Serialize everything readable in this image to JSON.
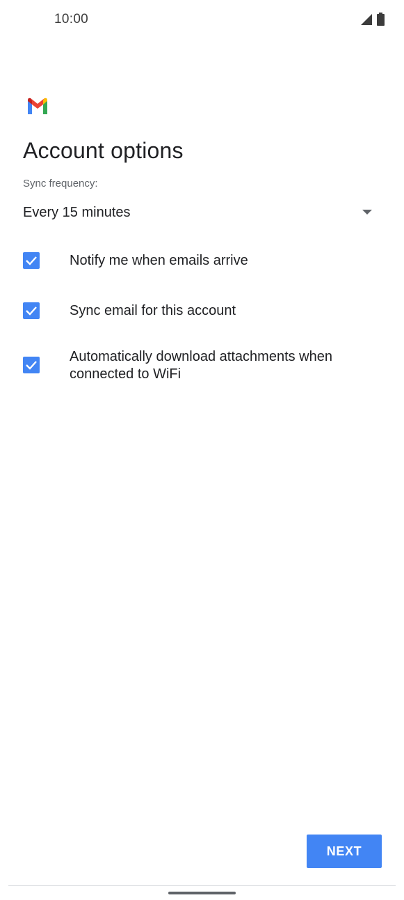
{
  "status_bar": {
    "time": "10:00",
    "icons": [
      "signal-icon",
      "battery-icon"
    ]
  },
  "app": {
    "logo": "gmail-logo",
    "brand_colors": {
      "blue": "#4285F4",
      "red": "#EA4335",
      "yellow": "#FBBC04",
      "green": "#34A853"
    }
  },
  "header": {
    "title": "Account options"
  },
  "sync": {
    "label": "Sync frequency:",
    "selected": "Every 15 minutes"
  },
  "options": [
    {
      "label": "Notify me when emails arrive",
      "checked": true
    },
    {
      "label": "Sync email for this account",
      "checked": true
    },
    {
      "label": "Automatically download attachments when connected to WiFi",
      "checked": true
    }
  ],
  "footer": {
    "next_label": "NEXT",
    "accent": "#4285F4"
  }
}
